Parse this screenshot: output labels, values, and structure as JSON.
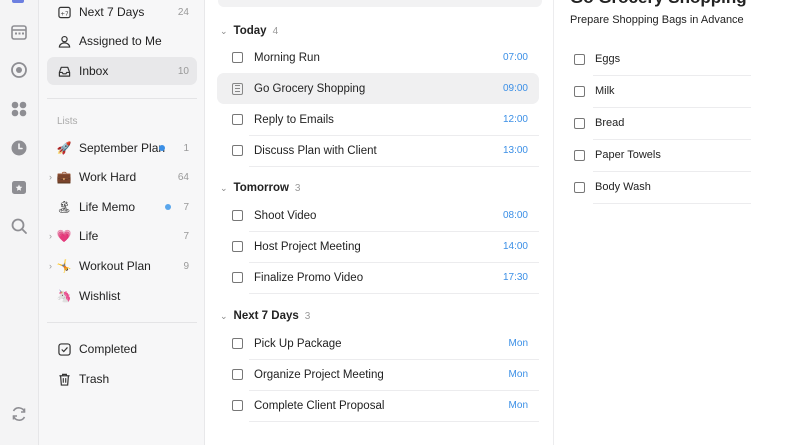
{
  "rail": {
    "icons": [
      "calendar-icon",
      "habit-icon",
      "matrix-icon",
      "clock-icon",
      "countdown-icon",
      "search-icon",
      "sync-icon"
    ]
  },
  "sidebar": {
    "smart_items": [
      {
        "label": "Next 7 Days",
        "count": "24",
        "icon": "next-7-days-icon"
      },
      {
        "label": "Assigned to Me",
        "count": "",
        "icon": "assigned-icon"
      },
      {
        "label": "Inbox",
        "count": "10",
        "icon": "inbox-icon"
      }
    ],
    "lists_heading": "Lists",
    "lists": [
      {
        "label": "September Plan",
        "count": "1",
        "emoji": "🚀",
        "dot": true,
        "caret": false
      },
      {
        "label": "Work Hard",
        "count": "64",
        "emoji": "💼",
        "dot": false,
        "caret": true
      },
      {
        "label": "Life Memo",
        "count": "7",
        "emoji": "🏝",
        "dot": true,
        "caret": false
      },
      {
        "label": "Life",
        "count": "7",
        "emoji": "💗",
        "dot": false,
        "caret": true
      },
      {
        "label": "Workout Plan",
        "count": "9",
        "emoji": "🤸",
        "dot": false,
        "caret": true
      },
      {
        "label": "Wishlist",
        "count": "",
        "emoji": "🦄",
        "dot": false,
        "caret": false
      }
    ],
    "bottom_items": [
      {
        "label": "Completed",
        "icon": "completed-icon"
      },
      {
        "label": "Trash",
        "icon": "trash-icon"
      }
    ]
  },
  "sections": [
    {
      "title": "Today",
      "count": "4",
      "tasks": [
        {
          "title": "Morning Run",
          "time": "07:00"
        },
        {
          "title": "Go Grocery Shopping",
          "time": "09:00",
          "active": true,
          "note": true
        },
        {
          "title": "Reply to Emails",
          "time": "12:00"
        },
        {
          "title": "Discuss Plan with Client",
          "time": "13:00"
        }
      ]
    },
    {
      "title": "Tomorrow",
      "count": "3",
      "tasks": [
        {
          "title": "Shoot Video",
          "time": "08:00"
        },
        {
          "title": "Host Project Meeting",
          "time": "14:00"
        },
        {
          "title": "Finalize Promo Video",
          "time": "17:30"
        }
      ]
    },
    {
      "title": "Next 7 Days",
      "count": "3",
      "tasks": [
        {
          "title": "Pick Up Package",
          "time": "Mon"
        },
        {
          "title": "Organize Project Meeting",
          "time": "Mon"
        },
        {
          "title": "Complete Client Proposal",
          "time": "Mon"
        }
      ]
    }
  ],
  "detail": {
    "title": "Go Grocery Shopping",
    "subtitle": "Prepare Shopping Bags in Advance",
    "checklist": [
      "Eggs",
      "Milk",
      "Bread",
      "Paper Towels",
      "Body Wash"
    ]
  },
  "colors": {
    "accent": "#3b8fe6",
    "rail_accent": "#6c7fe0"
  }
}
